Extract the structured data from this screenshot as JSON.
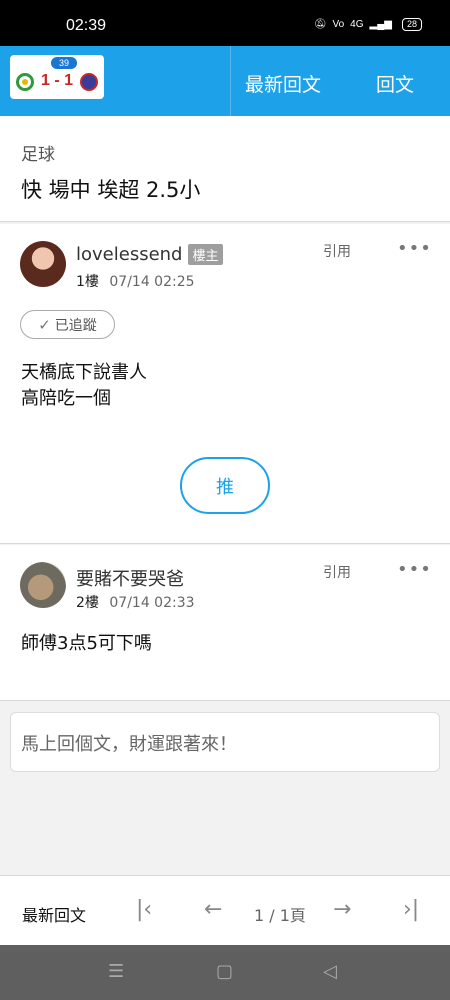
{
  "status_bar": {
    "time": "02:39",
    "signal_label": "4G",
    "battery": "28"
  },
  "top_bar": {
    "score_count": "39",
    "score": "1 - 1",
    "nav_latest": "最新回文",
    "nav_reply": "回文",
    "accent_color": "#1da1e8"
  },
  "topic": {
    "category": "足球",
    "title": "快 場中 埃超 2.5小"
  },
  "posts": [
    {
      "author": "lovelessend",
      "op_badge": "樓主",
      "floor": "1樓",
      "time": "07/14 02:25",
      "quote": "引用",
      "more": "•••",
      "tracked": "已追蹤",
      "body_lines": [
        "天橋底下說書人",
        "高陪吃一個"
      ],
      "push": "推"
    },
    {
      "author": "要賭不要哭爸",
      "floor": "2樓",
      "time": "07/14 02:33",
      "quote": "引用",
      "more": "•••",
      "body_lines": [
        "師傅3点5可下嗎"
      ]
    }
  ],
  "reply_box": {
    "placeholder": "馬上回個文，財運跟著來！"
  },
  "pager": {
    "latest": "最新回文",
    "page_text": "1 / 1頁",
    "first_icon": "first-page-icon",
    "prev_icon": "arrow-left-icon",
    "next_icon": "arrow-right-icon",
    "last_icon": "last-page-icon"
  },
  "android_nav": {
    "menu_icon": "menu-icon",
    "home_icon": "home-icon",
    "back_icon": "back-icon"
  }
}
